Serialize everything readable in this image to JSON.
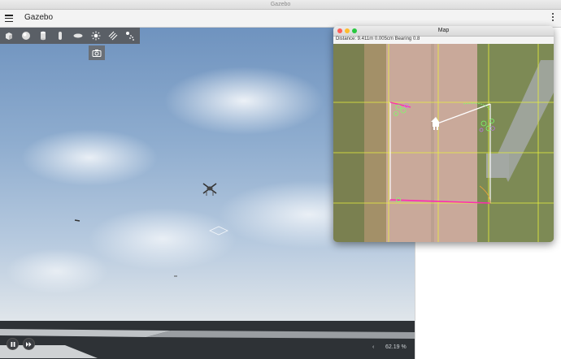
{
  "window": {
    "title": "Gazebo"
  },
  "appbar": {
    "title": "Gazebo"
  },
  "toolbar": {
    "tools": [
      "box-icon",
      "sphere-icon",
      "cylinder-icon",
      "capsule-icon",
      "ellipsoid-icon",
      "sun-icon",
      "directional-light-icon",
      "spot-light-icon"
    ],
    "screenshot": "camera-icon"
  },
  "playback": {
    "rtf": "62.19 %",
    "rewind": "‹"
  },
  "map": {
    "title": "Map",
    "info": "Distance: 9.411m 0.005cm Bearing 0.8"
  },
  "colors": {
    "path": "#ff2bb0",
    "grid": "#e9f23c",
    "waypoint": "#7cff6a"
  }
}
